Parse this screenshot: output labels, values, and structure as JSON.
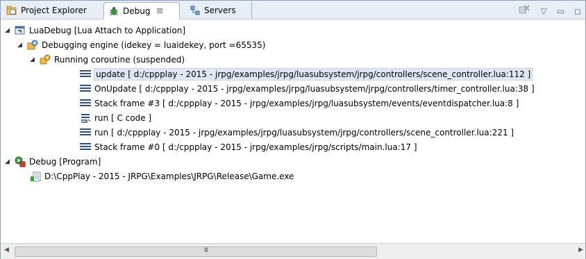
{
  "tabs": [
    {
      "label": "Project Explorer",
      "icon": "project-explorer-icon"
    },
    {
      "label": "Debug",
      "icon": "debug-bug-icon"
    },
    {
      "label": "Servers",
      "icon": "servers-icon"
    }
  ],
  "toolbar": {
    "remove_icon": "remove-terminated-icon",
    "view_menu_icon": "view-menu-icon",
    "minimize_icon": "minimize-icon",
    "maximize_icon": "maximize-icon"
  },
  "tree": {
    "items": [
      {
        "label": "LuaDebug [Lua Attach to Application]",
        "icon": "launch-config-icon",
        "expanded": true
      },
      {
        "label": "Debugging engine (idekey = luaidekey, port =65535)",
        "icon": "debug-engine-icon",
        "expanded": true
      },
      {
        "label": "Running coroutine (suspended)",
        "icon": "coroutine-icon",
        "expanded": true
      },
      {
        "label": "update  [ d:/cppplay - 2015 - jrpg/examples/jrpg/luasubsystem/jrpg/controllers/scene_controller.lua:112 ]",
        "icon": "stack-frame-icon",
        "selected": true
      },
      {
        "label": "OnUpdate  [ d:/cppplay - 2015 - jrpg/examples/jrpg/luasubsystem/jrpg/controllers/timer_controller.lua:38 ]",
        "icon": "stack-frame-icon"
      },
      {
        "label": "Stack frame #3  [ d:/cppplay - 2015 - jrpg/examples/jrpg/luasubsystem/events/eventdispatcher.lua:8 ]",
        "icon": "stack-frame-icon"
      },
      {
        "label": "run  [ C code ]",
        "icon": "c-stack-frame-icon"
      },
      {
        "label": "run  [ d:/cppplay - 2015 - jrpg/examples/jrpg/luasubsystem/jrpg/controllers/scene_controller.lua:221 ]",
        "icon": "stack-frame-icon"
      },
      {
        "label": "Stack frame #0  [ d:/cppplay - 2015 - jrpg/examples/jrpg/scripts/main.lua:17 ]",
        "icon": "stack-frame-icon"
      },
      {
        "label": "Debug [Program]",
        "icon": "program-launch-icon",
        "expanded": true
      },
      {
        "label": "D:\\CppPlay - 2015 - JRPG\\Examples\\JRPG\\Release\\Game.exe",
        "icon": "process-icon"
      }
    ]
  },
  "scrollbar": {
    "grip": "III"
  },
  "colors": {
    "selection": "#dfe7f2",
    "frame_icon": "#2a4f8a",
    "tab_bar": "#e8eef6"
  }
}
